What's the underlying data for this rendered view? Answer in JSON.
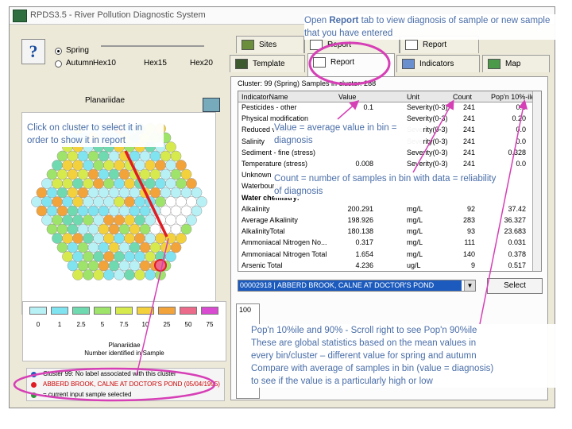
{
  "window": {
    "title": "RPDS3.5 - River Pollution Diagnostic System"
  },
  "left": {
    "season": {
      "spring_label": "Spring",
      "autumn_label": "Autumn",
      "spring_selected": true
    },
    "hex_labels": [
      "Hex10",
      "Hex15",
      "Hex20"
    ],
    "map_title": "Planariidae",
    "legend": {
      "values": [
        "0",
        "1",
        "2.5",
        "5",
        "7.5",
        "10",
        "25",
        "50",
        "75"
      ],
      "colors": [
        "#b7f0f5",
        "#7fe3f0",
        "#6fd9b0",
        "#9ee36a",
        "#d6ea4e",
        "#f3d13c",
        "#f2a33a",
        "#ec6b8a",
        "#d94bd0"
      ],
      "title": "Planariidae",
      "subtitle": "Number identified in Sample"
    },
    "status": [
      "Cluster 99: No label associated with this cluster",
      "ABBERD BROOK, CALNE AT DOCTOR'S POND (05/04/1995)",
      "= current input sample selected"
    ]
  },
  "tabs": {
    "top_row": [
      "Sites",
      "Report",
      "Report"
    ],
    "bottom_row": [
      "Template",
      "Report",
      "Indicators",
      "Map"
    ],
    "active": "Report"
  },
  "report": {
    "cluster_info": "Cluster: 99 (Spring)   Samples in cluster: 288",
    "columns": [
      "IndicatorName",
      "Value",
      "Unit",
      "Count",
      "Pop'n 10%-ile"
    ],
    "rows": [
      [
        "Pesticides - other",
        "0.1",
        "Severity(0-3)",
        "241",
        "0.0"
      ],
      [
        "Physical modification",
        "",
        "Severity(0-3)",
        "241",
        "0.20"
      ],
      [
        "Reduced velocity",
        "",
        "Severity(0-3)",
        "241",
        "0.0"
      ],
      [
        "Salinity",
        "",
        "Severity(0-3)",
        "241",
        "0.0"
      ],
      [
        "Sediment - fine (stress)",
        "",
        "Severity(0-3)",
        "241",
        "0.328"
      ],
      [
        "Temperature (stress)",
        "0.008",
        "Severity(0-3)",
        "241",
        "0.0"
      ],
      [
        "Unknown",
        "",
        "",
        "",
        ""
      ],
      [
        "Waterbourne",
        "",
        "",
        "",
        ""
      ],
      [
        "Water chemistry:",
        "",
        "",
        "",
        ""
      ],
      [
        "Alkalinity",
        "200.291",
        "mg/L",
        "92",
        "37.42"
      ],
      [
        "Average Alkalinity",
        "198.926",
        "mg/L",
        "283",
        "36.327"
      ],
      [
        "AlkalinityTotal",
        "180.138",
        "mg/L",
        "93",
        "23.683"
      ],
      [
        "Ammoniacal Nitrogen No...",
        "0.317",
        "mg/L",
        "111",
        "0.031"
      ],
      [
        "Ammoniacal Nitrogen Total",
        "1.654",
        "mg/L",
        "140",
        "0.378"
      ],
      [
        "Arsenic Total",
        "4.236",
        "ug/L",
        "9",
        "0.517"
      ]
    ],
    "sample_select": "00002918 | ABBERD BROOK, CALNE AT DOCTOR'S POND",
    "select_button": "Select",
    "chart_axis_top": "100"
  },
  "callouts": {
    "report_tab_pre": "Open ",
    "report_tab_bold": "Report",
    "report_tab_post": " tab to view diagnosis of sample or new sample that you have entered",
    "cluster": "Click on cluster to select it in order to show it in report",
    "value": "Value = average value in bin = diagnosis",
    "count": "Count = number of samples in bin with data = reliability of diagnosis",
    "popn_lines": [
      "Pop'n 10%ile and 90% - Scroll right to see Pop'n 90%ile",
      "These are global statistics based on the mean values in",
      "every bin/cluster – different value for spring and autumn",
      "Compare with average of samples in bin (value = diagnosis)",
      "to see if the value is a particularly high or low"
    ]
  },
  "colors": {
    "callout_text": "#4a6ea8",
    "annotation_line": "#d63fb6",
    "arrow_red": "#e01b24",
    "selection_blue": "#1c5bbd"
  }
}
